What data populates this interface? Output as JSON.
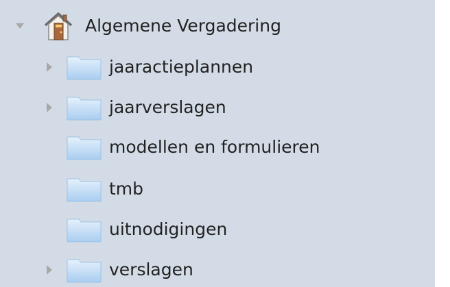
{
  "tree": {
    "root": {
      "label": "Algemene Vergadering",
      "icon": "home-icon",
      "expanded": true
    },
    "children": [
      {
        "label": "jaaractieplannen",
        "icon": "folder-icon",
        "has_children": true
      },
      {
        "label": "jaarverslagen",
        "icon": "folder-icon",
        "has_children": true
      },
      {
        "label": "modellen en formulieren",
        "icon": "folder-icon",
        "has_children": false
      },
      {
        "label": "tmb",
        "icon": "folder-icon",
        "has_children": false
      },
      {
        "label": "uitnodigingen",
        "icon": "folder-icon",
        "has_children": false
      },
      {
        "label": "verslagen",
        "icon": "folder-icon",
        "has_children": true
      }
    ]
  },
  "colors": {
    "background": "#d3dce6",
    "folder_light": "#e6f1fc",
    "folder_dark": "#a9cdf0",
    "twisty": "#a8a8a8",
    "text": "#222222"
  }
}
